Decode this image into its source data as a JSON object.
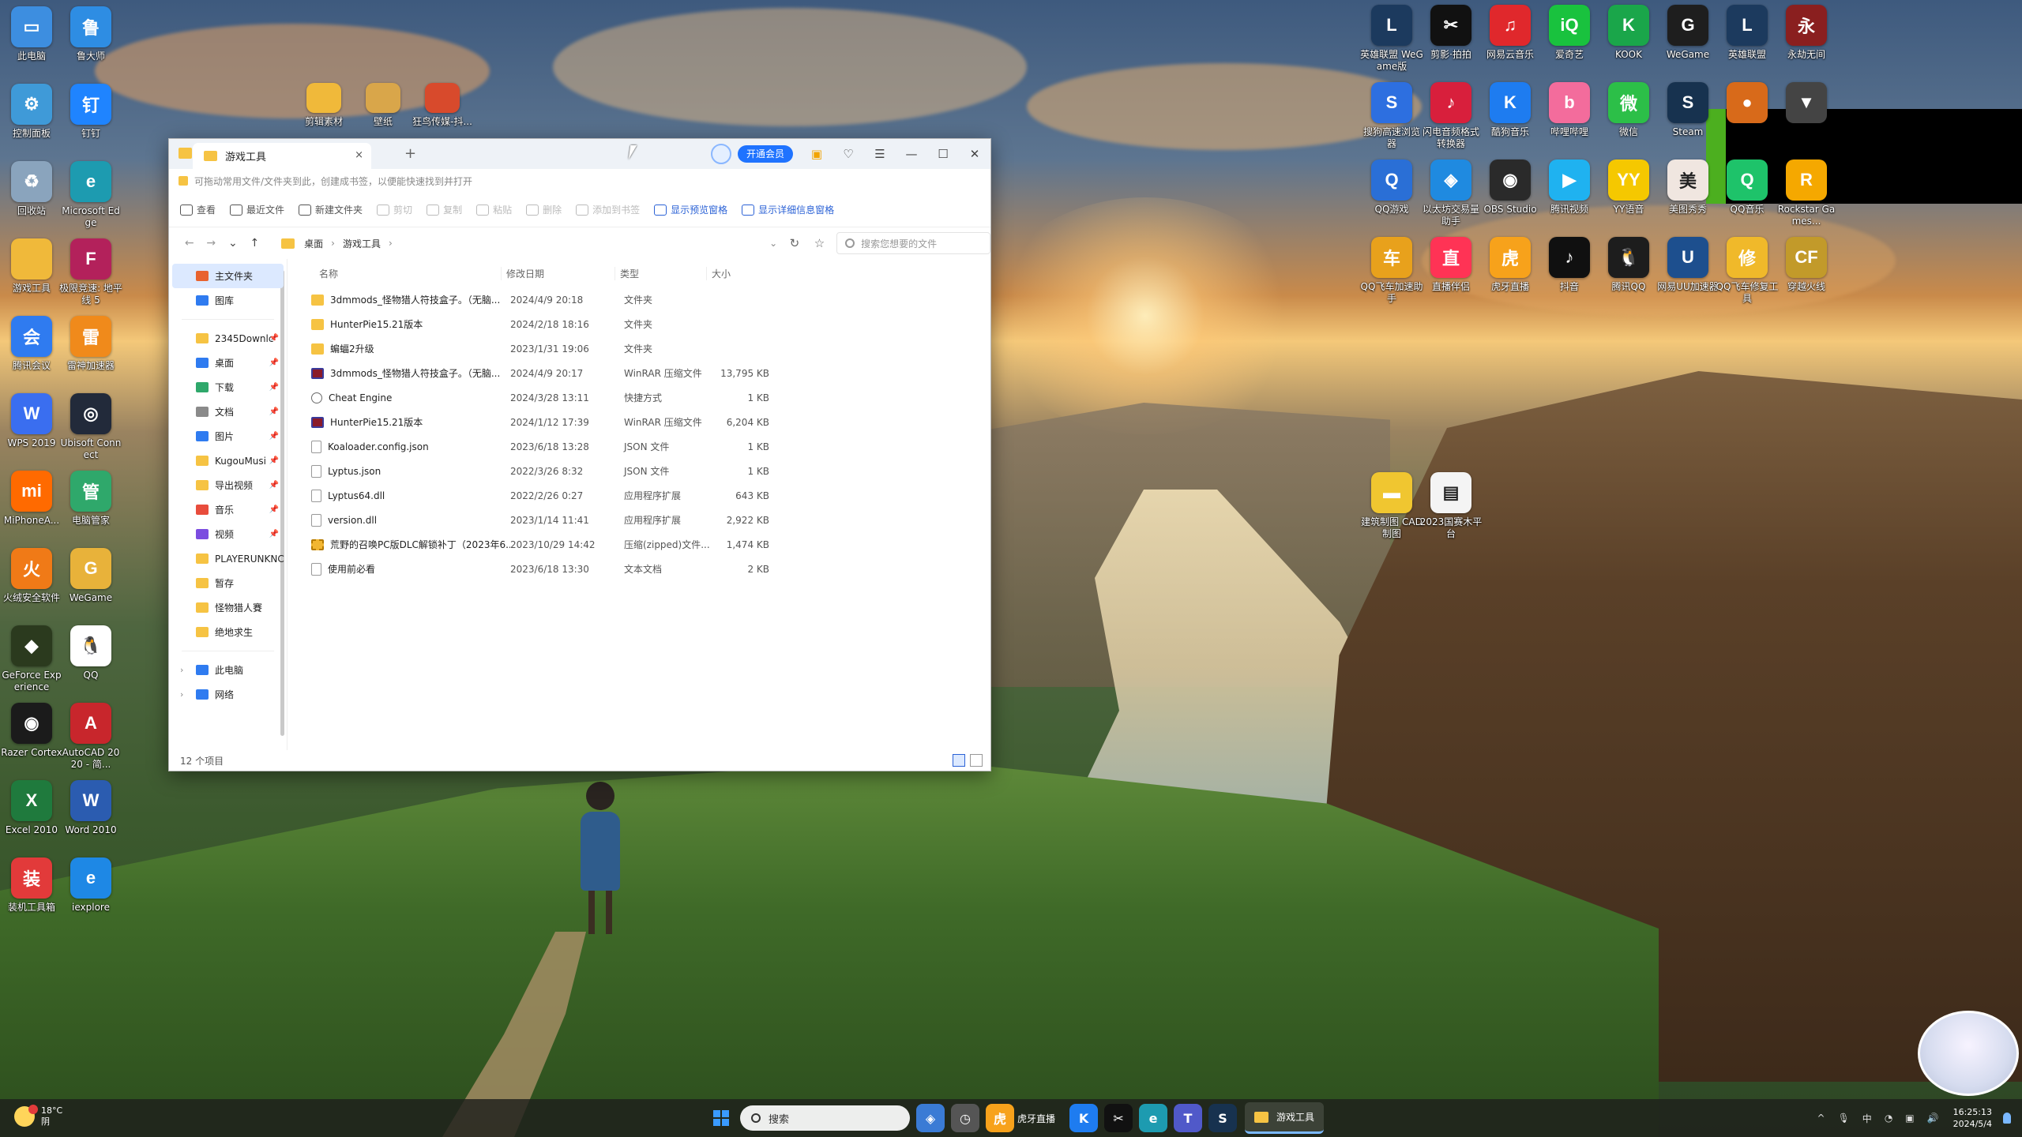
{
  "desktop": {
    "left_icons": [
      {
        "label": "此电脑",
        "icon": "computer-icon",
        "color": "#3d8ee0",
        "glyph": "▭"
      },
      {
        "label": "鲁大师",
        "icon": "ludashi-icon",
        "color": "#2e8de3",
        "glyph": "鲁"
      },
      {
        "label": "控制面板",
        "icon": "control-panel-icon",
        "color": "#3f9ad8",
        "glyph": "⚙"
      },
      {
        "label": "钉钉",
        "icon": "dingtalk-icon",
        "color": "#1f84ff",
        "glyph": "钉"
      },
      {
        "label": "回收站",
        "icon": "recycle-bin-icon",
        "color": "#8aa4bd",
        "glyph": "♻"
      },
      {
        "label": "Microsoft Edge",
        "icon": "edge-icon",
        "color": "#1d9bb0",
        "glyph": "e"
      },
      {
        "label": "游戏工具",
        "icon": "folder-icon",
        "color": "#f0b93a",
        "glyph": ""
      },
      {
        "label": "极限竞速: 地平线 5",
        "icon": "forza-icon",
        "color": "#b3215b",
        "glyph": "F"
      },
      {
        "label": "腾讯会议",
        "icon": "tencent-meeting-icon",
        "color": "#2f7bf0",
        "glyph": "会"
      },
      {
        "label": "雷神加速器",
        "icon": "leishen-icon",
        "color": "#f08a1b",
        "glyph": "雷"
      },
      {
        "label": "WPS 2019",
        "icon": "wps-icon",
        "color": "#3a6ef0",
        "glyph": "W"
      },
      {
        "label": "Ubisoft Connect",
        "icon": "ubisoft-icon",
        "color": "#222a3a",
        "glyph": "◎"
      },
      {
        "label": "MiPhoneA...",
        "icon": "mi-icon",
        "color": "#ff6a00",
        "glyph": "mi"
      },
      {
        "label": "电脑管家",
        "icon": "pc-manager-icon",
        "color": "#2fa86b",
        "glyph": "管"
      },
      {
        "label": "火绒安全软件",
        "icon": "huorong-icon",
        "color": "#f07a17",
        "glyph": "火"
      },
      {
        "label": "WeGame",
        "icon": "wegame-icon",
        "color": "#e8b23a",
        "glyph": "G"
      },
      {
        "label": "GeForce Experience",
        "icon": "geforce-icon",
        "color": "#2b3a1e",
        "glyph": "◆"
      },
      {
        "label": "QQ",
        "icon": "qq-icon",
        "color": "#ffffff",
        "glyph": "🐧"
      },
      {
        "label": "Razer Cortex",
        "icon": "razer-icon",
        "color": "#1b1b1b",
        "glyph": "◉"
      },
      {
        "label": "AutoCAD 2020 - 简...",
        "icon": "autocad-icon",
        "color": "#c8262c",
        "glyph": "A"
      },
      {
        "label": "Excel 2010",
        "icon": "excel-icon",
        "color": "#1f7a3d",
        "glyph": "X"
      },
      {
        "label": "Word 2010",
        "icon": "word-icon",
        "color": "#2b5cb0",
        "glyph": "W"
      },
      {
        "label": "装机工具箱",
        "icon": "toolbox-icon",
        "color": "#e23a3a",
        "glyph": "装"
      },
      {
        "label": "iexplore",
        "icon": "ie-icon",
        "color": "#1e88e5",
        "glyph": "e"
      }
    ],
    "top_files": [
      {
        "label": "剪辑素材",
        "icon": "folder-icon",
        "color": "#f0b93a"
      },
      {
        "label": "壁纸",
        "icon": "folder-photos-icon",
        "color": "#d9a64a"
      },
      {
        "label": "狂鸟传媒-抖...",
        "icon": "ppt-file-icon",
        "color": "#d84a2c"
      }
    ],
    "right_icons": [
      {
        "label": "英雄联盟 WeGame版",
        "icon": "lol-icon",
        "color": "#1c3a5e",
        "glyph": "L"
      },
      {
        "label": "剪影·拍拍",
        "icon": "capcut-icon",
        "color": "#111111",
        "glyph": "✂"
      },
      {
        "label": "网易云音乐",
        "icon": "netease-music-icon",
        "color": "#e0282c",
        "glyph": "♫"
      },
      {
        "label": "爱奇艺",
        "icon": "iqiyi-icon",
        "color": "#19c23e",
        "glyph": "iQ"
      },
      {
        "label": "KOOK",
        "icon": "kook-icon",
        "color": "#1aa64a",
        "glyph": "K"
      },
      {
        "label": "WeGame",
        "icon": "wegame-icon",
        "color": "#1e1e1e",
        "glyph": "G"
      },
      {
        "label": "英雄联盟",
        "icon": "lol-icon",
        "color": "#1c3a5e",
        "glyph": "L"
      },
      {
        "label": "永劫无间",
        "icon": "naraka-icon",
        "color": "#8a1f1f",
        "glyph": "永"
      },
      {
        "label": "搜狗高速浏览器",
        "icon": "sogou-browser-icon",
        "color": "#2d6fe0",
        "glyph": "S"
      },
      {
        "label": "闪电音频格式转换器",
        "icon": "audio-converter-icon",
        "color": "#d81f3c",
        "glyph": "♪"
      },
      {
        "label": "酷狗音乐",
        "icon": "kugou-icon",
        "color": "#1e7cf0",
        "glyph": "K"
      },
      {
        "label": "哔哩哔哩",
        "icon": "bilibili-icon",
        "color": "#f36c9c",
        "glyph": "b"
      },
      {
        "label": "微信",
        "icon": "wechat-icon",
        "color": "#2cbf48",
        "glyph": "微"
      },
      {
        "label": "Steam",
        "icon": "steam-icon",
        "color": "#17324f",
        "glyph": "S"
      },
      {
        "label": "",
        "icon": "basketball-icon",
        "color": "#d86a1a",
        "glyph": "●"
      },
      {
        "label": "",
        "icon": "game-icon",
        "color": "#444444",
        "glyph": "▼"
      },
      {
        "label": "QQ游戏",
        "icon": "qq-game-icon",
        "color": "#2a6fd6",
        "glyph": "Q"
      },
      {
        "label": "以太坊交易量助手",
        "icon": "exchange-icon",
        "color": "#1f8ae0",
        "glyph": "◈"
      },
      {
        "label": "OBS Studio",
        "icon": "obs-icon",
        "color": "#2a2a2a",
        "glyph": "◉"
      },
      {
        "label": "腾讯视频",
        "icon": "tencent-video-icon",
        "color": "#1fb2f0",
        "glyph": "▶"
      },
      {
        "label": "YY语音",
        "icon": "yy-icon",
        "color": "#f5c800",
        "glyph": "YY"
      },
      {
        "label": "美图秀秀",
        "icon": "meitu-icon",
        "color": "#f0e6e0",
        "glyph": "美"
      },
      {
        "label": "QQ音乐",
        "icon": "qq-music-icon",
        "color": "#1ec36a",
        "glyph": "Q"
      },
      {
        "label": "Rockstar Games...",
        "icon": "rockstar-icon",
        "color": "#f5a800",
        "glyph": "R"
      },
      {
        "label": "QQ飞车加速助手",
        "icon": "speed-icon",
        "color": "#e8a11c",
        "glyph": "车"
      },
      {
        "label": "直播伴侣",
        "icon": "live-icon",
        "color": "#ff3355",
        "glyph": "直"
      },
      {
        "label": "虎牙直播",
        "icon": "huya-icon",
        "color": "#f7a21b",
        "glyph": "虎"
      },
      {
        "label": "抖音",
        "icon": "douyin-icon",
        "color": "#101010",
        "glyph": "♪"
      },
      {
        "label": "腾讯QQ",
        "icon": "qq-icon",
        "color": "#1d1d1d",
        "glyph": "🐧"
      },
      {
        "label": "网易UU加速器",
        "icon": "uu-icon",
        "color": "#1d4f8e",
        "glyph": "U"
      },
      {
        "label": "QQ飞车修复工具",
        "icon": "repair-icon",
        "color": "#f0b92a",
        "glyph": "修"
      },
      {
        "label": "穿越火线",
        "icon": "cf-icon",
        "color": "#c29a2a",
        "glyph": "CF"
      }
    ],
    "mid_icons": [
      {
        "label": "建筑制图 CAD制图",
        "icon": "cad-folder-icon",
        "color": "#f0c630",
        "glyph": "▬"
      },
      {
        "label": "2023国赛木平台",
        "icon": "doc-file-icon",
        "color": "#f4f4f4",
        "glyph": "▤"
      }
    ]
  },
  "window": {
    "tab_title": "游戏工具",
    "tab_close": "×",
    "tab_add": "+",
    "vip_label": "开通会员",
    "controls": {
      "gift": "▣",
      "shirt": "♡",
      "menu": "☰",
      "min": "—",
      "max": "☐",
      "close": "✕"
    },
    "notice": "可拖动常用文件/文件夹到此，创建成书签，以便能快速找到并打开",
    "toolbar": [
      {
        "label": "查看",
        "icon": "view-icon",
        "state": "normal"
      },
      {
        "label": "最近文件",
        "icon": "recent-icon",
        "state": "normal"
      },
      {
        "label": "新建文件夹",
        "icon": "new-folder-icon",
        "state": "normal"
      },
      {
        "label": "剪切",
        "icon": "cut-icon",
        "state": "disabled"
      },
      {
        "label": "复制",
        "icon": "copy-icon",
        "state": "disabled"
      },
      {
        "label": "粘贴",
        "icon": "paste-icon",
        "state": "disabled"
      },
      {
        "label": "删除",
        "icon": "delete-icon",
        "state": "disabled"
      },
      {
        "label": "添加到书签",
        "icon": "bookmark-icon",
        "state": "disabled"
      },
      {
        "label": "显示预览窗格",
        "icon": "preview-pane-icon",
        "state": "blue"
      },
      {
        "label": "显示详细信息窗格",
        "icon": "details-pane-icon",
        "state": "blue"
      }
    ],
    "nav": {
      "back": "←",
      "forward": "→",
      "dropdown": "⌄",
      "up": "↑"
    },
    "breadcrumb": [
      "桌面",
      "游戏工具"
    ],
    "breadcrumb_sep": "›",
    "address_dropdown": "⌄",
    "refresh": "↻",
    "favorite": "☆",
    "search_placeholder": "搜索您想要的文件",
    "sidebar": {
      "top": [
        {
          "label": "主文件夹",
          "icon": "home-icon",
          "color": "#e8622e",
          "selected": true
        },
        {
          "label": "图库",
          "icon": "gallery-icon",
          "color": "#2f7bf0",
          "selected": false
        }
      ],
      "pinned": [
        {
          "label": "2345Downlc",
          "icon": "folder-icon",
          "color": "#f6c343"
        },
        {
          "label": "桌面",
          "icon": "desktop-icon",
          "color": "#2f7bf0"
        },
        {
          "label": "下载",
          "icon": "download-icon",
          "color": "#2fa86b"
        },
        {
          "label": "文档",
          "icon": "documents-icon",
          "color": "#8a8a8a"
        },
        {
          "label": "图片",
          "icon": "pictures-icon",
          "color": "#2f7bf0"
        },
        {
          "label": "KugouMusi",
          "icon": "folder-icon",
          "color": "#f6c343"
        },
        {
          "label": "导出视频",
          "icon": "folder-icon",
          "color": "#f6c343"
        },
        {
          "label": "音乐",
          "icon": "music-icon",
          "color": "#e84c3c"
        },
        {
          "label": "视频",
          "icon": "videos-icon",
          "color": "#7b4ce0"
        },
        {
          "label": "PLAYERUNKNC",
          "icon": "folder-icon",
          "color": "#f6c343"
        },
        {
          "label": "暂存",
          "icon": "folder-icon",
          "color": "#f6c343"
        },
        {
          "label": "怪物猎人賽",
          "icon": "folder-icon",
          "color": "#f6c343"
        },
        {
          "label": "绝地求生",
          "icon": "folder-icon",
          "color": "#f6c343"
        }
      ],
      "pin_glyph": "📌",
      "bottom": [
        {
          "label": "此电脑",
          "icon": "this-pc-icon",
          "color": "#2f7bf0"
        },
        {
          "label": "网络",
          "icon": "network-icon",
          "color": "#2f7bf0"
        }
      ],
      "chevron": "›"
    },
    "columns": {
      "name": "名称",
      "date": "修改日期",
      "type": "类型",
      "size": "大小"
    },
    "files": [
      {
        "name": "3dmmods_怪物猎人符技盒子。（无脑...",
        "date": "2024/4/9 20:18",
        "type": "文件夹",
        "size": "",
        "kind": "folder"
      },
      {
        "name": "HunterPie15.21版本",
        "date": "2024/2/18 18:16",
        "type": "文件夹",
        "size": "",
        "kind": "folder"
      },
      {
        "name": "蝙蝠2升级",
        "date": "2023/1/31 19:06",
        "type": "文件夹",
        "size": "",
        "kind": "folder"
      },
      {
        "name": "3dmmods_怪物猎人符技盒子。（无脑...",
        "date": "2024/4/9 20:17",
        "type": "WinRAR 压缩文件",
        "size": "13,795 KB",
        "kind": "rar"
      },
      {
        "name": "Cheat Engine",
        "date": "2024/3/28 13:11",
        "type": "快捷方式",
        "size": "1 KB",
        "kind": "lnk"
      },
      {
        "name": "HunterPie15.21版本",
        "date": "2024/1/12 17:39",
        "type": "WinRAR 压缩文件",
        "size": "6,204 KB",
        "kind": "rar"
      },
      {
        "name": "Koaloader.config.json",
        "date": "2023/6/18 13:28",
        "type": "JSON 文件",
        "size": "1 KB",
        "kind": "doc"
      },
      {
        "name": "Lyptus.json",
        "date": "2022/3/26 8:32",
        "type": "JSON 文件",
        "size": "1 KB",
        "kind": "doc"
      },
      {
        "name": "Lyptus64.dll",
        "date": "2022/2/26 0:27",
        "type": "应用程序扩展",
        "size": "643 KB",
        "kind": "doc"
      },
      {
        "name": "version.dll",
        "date": "2023/1/14 11:41",
        "type": "应用程序扩展",
        "size": "2,922 KB",
        "kind": "doc"
      },
      {
        "name": "荒野的召唤PC版DLC解锁补丁（2023年6...",
        "date": "2023/10/29 14:42",
        "type": "压缩(zipped)文件...",
        "size": "1,474 KB",
        "kind": "zip"
      },
      {
        "name": "使用前必看",
        "date": "2023/6/18 13:30",
        "type": "文本文档",
        "size": "2 KB",
        "kind": "doc"
      }
    ],
    "status": "12 个项目"
  },
  "taskbar": {
    "weather_temp": "18°C",
    "weather_desc": "阴",
    "search_placeholder": "搜索",
    "apps": [
      {
        "icon": "widgets-icon",
        "color": "#3a7bd5",
        "glyph": "◈",
        "label": ""
      },
      {
        "icon": "clock-app-icon",
        "color": "#555555",
        "glyph": "◷",
        "label": ""
      },
      {
        "icon": "huya-icon",
        "color": "#f7a21b",
        "glyph": "虎",
        "label": "虎牙直播"
      },
      {
        "icon": "kugou-icon",
        "color": "#1e7cf0",
        "glyph": "K",
        "label": ""
      },
      {
        "icon": "capcut-icon",
        "color": "#111111",
        "glyph": "✂",
        "label": ""
      },
      {
        "icon": "edge-icon",
        "color": "#1d9bb0",
        "glyph": "e",
        "label": ""
      },
      {
        "icon": "teams-icon",
        "color": "#5059c9",
        "glyph": "T",
        "label": ""
      },
      {
        "icon": "steam-icon",
        "color": "#17324f",
        "glyph": "S",
        "label": ""
      }
    ],
    "active_window_label": "游戏工具",
    "tray": {
      "chevron": "^",
      "mic": "🎙",
      "ime": "中",
      "wifi": "◔",
      "volume": "🔊",
      "network": "▣"
    },
    "time": "16:25:13",
    "date": "2024/5/4"
  }
}
